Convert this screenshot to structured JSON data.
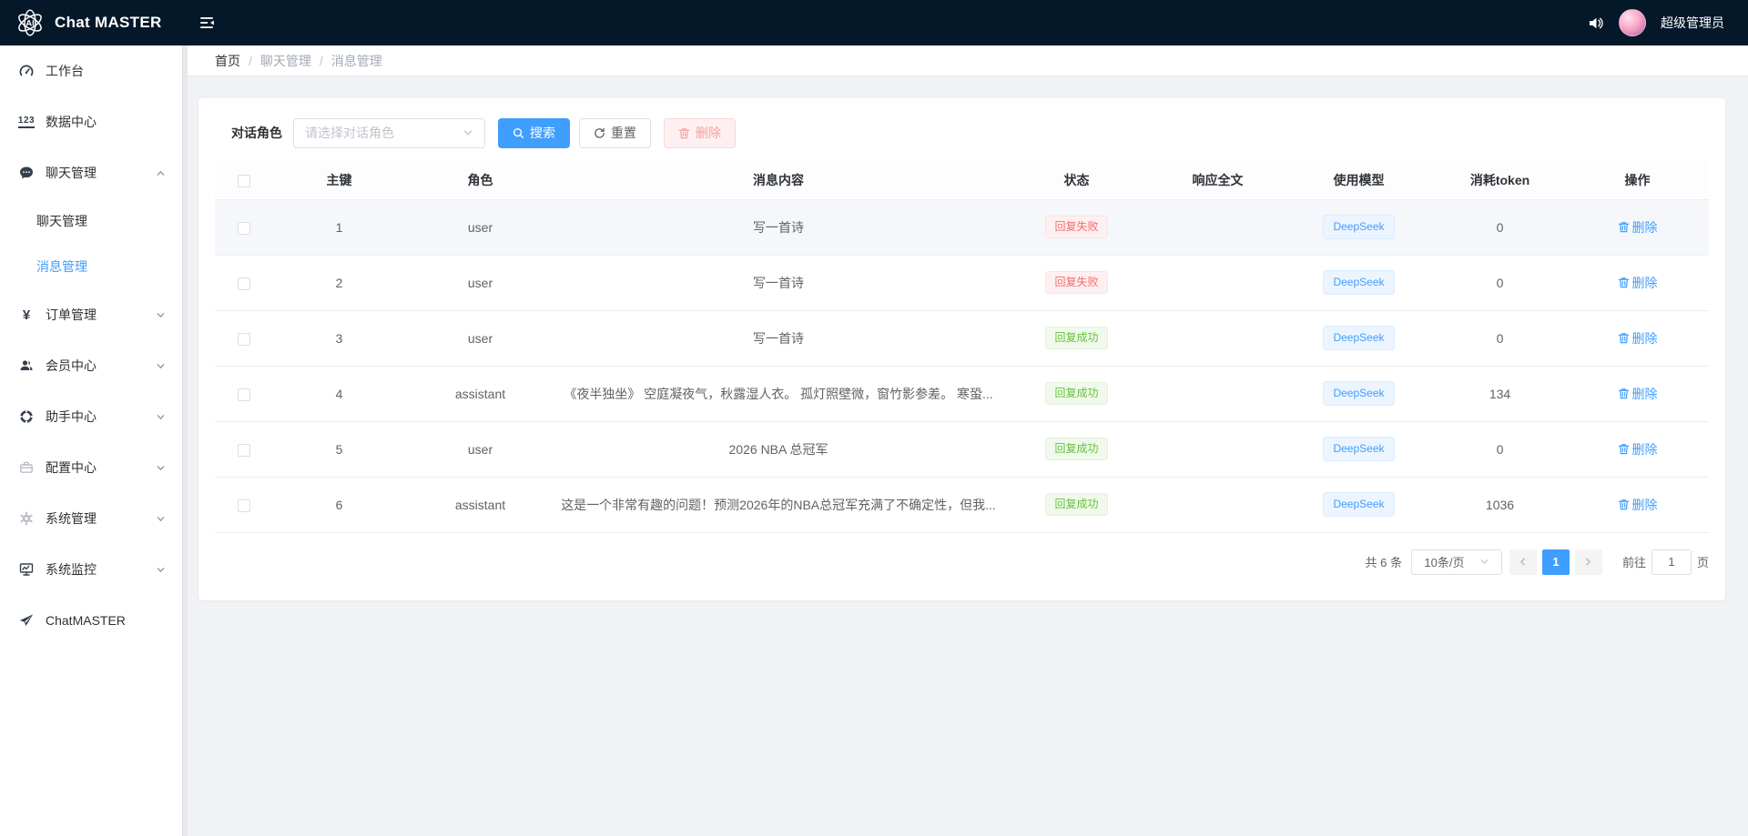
{
  "app": {
    "title": "Chat MASTER",
    "username": "超级管理员"
  },
  "icons": {
    "logo": "atom-ai-logo",
    "fold": "menu-fold",
    "volume": "speaker",
    "workbench": "gauge",
    "data_center": "123-underline",
    "chat": "chat-bubble",
    "order": "yen-sign",
    "member": "user-silhouette",
    "assistant": "life-ring",
    "config": "briefcase",
    "system": "gear",
    "monitor": "monitor-screen",
    "chatmaster": "paper-plane",
    "search": "magnifier",
    "reset": "refresh",
    "delete": "trash",
    "select_arrow": "chevron-down",
    "pager_prev": "chevron-left",
    "pager_next": "chevron-right"
  },
  "colors": {
    "primary": "#409eff",
    "danger": "#f56c6c",
    "success": "#67c23a",
    "header_bg": "#051829",
    "page_bg": "#f0f2f5",
    "row_highlight": "#f5f7fa",
    "danger_badge_bg": "#fef0f0",
    "success_badge_bg": "#f0f9eb",
    "model_tag_bg": "#ecf5ff"
  },
  "sidebar": {
    "items": [
      {
        "label": "工作台"
      },
      {
        "label": "数据中心",
        "icon_char": "123"
      },
      {
        "label": "聊天管理",
        "expanded": true,
        "children": [
          {
            "label": "聊天管理"
          },
          {
            "label": "消息管理",
            "active": true
          }
        ]
      },
      {
        "label": "订单管理",
        "icon_char": "¥"
      },
      {
        "label": "会员中心"
      },
      {
        "label": "助手中心"
      },
      {
        "label": "配置中心"
      },
      {
        "label": "系统管理"
      },
      {
        "label": "系统监控"
      },
      {
        "label": "ChatMASTER"
      }
    ]
  },
  "breadcrumb": {
    "items": [
      "首页",
      "聊天管理",
      "消息管理"
    ],
    "separator": "/"
  },
  "filter": {
    "label": "对话角色",
    "placeholder": "请选择对话角色",
    "search": "搜索",
    "reset": "重置",
    "delete": "删除"
  },
  "table": {
    "headers": [
      "主键",
      "角色",
      "消息内容",
      "状态",
      "响应全文",
      "使用模型",
      "消耗token",
      "操作"
    ],
    "rows": [
      {
        "key": "1",
        "role": "user",
        "content": "写一首诗",
        "status": "回复失败",
        "status_type": "danger",
        "response": "",
        "model": "DeepSeek",
        "tokens": "0",
        "action": "删除",
        "highlight": true
      },
      {
        "key": "2",
        "role": "user",
        "content": "写一首诗",
        "status": "回复失败",
        "status_type": "danger",
        "response": "",
        "model": "DeepSeek",
        "tokens": "0",
        "action": "删除"
      },
      {
        "key": "3",
        "role": "user",
        "content": "写一首诗",
        "status": "回复成功",
        "status_type": "success",
        "response": "",
        "model": "DeepSeek",
        "tokens": "0",
        "action": "删除"
      },
      {
        "key": "4",
        "role": "assistant",
        "content": "《夜半独坐》 空庭凝夜气，秋露湿人衣。 孤灯照壁微，窗竹影参差。 寒蛩...",
        "status": "回复成功",
        "status_type": "success",
        "response": "",
        "model": "DeepSeek",
        "tokens": "134",
        "action": "删除"
      },
      {
        "key": "5",
        "role": "user",
        "content": "2026 NBA 总冠军",
        "status": "回复成功",
        "status_type": "success",
        "response": "",
        "model": "DeepSeek",
        "tokens": "0",
        "action": "删除"
      },
      {
        "key": "6",
        "role": "assistant",
        "content": "这是一个非常有趣的问题！预测2026年的NBA总冠军充满了不确定性，但我...",
        "status": "回复成功",
        "status_type": "success",
        "response": "",
        "model": "DeepSeek",
        "tokens": "1036",
        "action": "删除"
      }
    ]
  },
  "pagination": {
    "total": "共 6 条",
    "size": "10条/页",
    "page": "1",
    "goto_label": "前往",
    "goto_value": "1",
    "unit": "页"
  }
}
